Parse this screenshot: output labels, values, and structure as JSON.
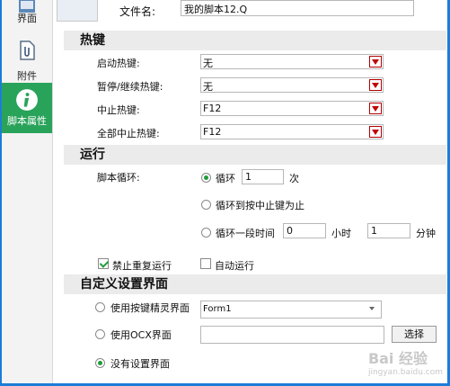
{
  "sidebar": {
    "items": [
      {
        "label": "界面",
        "icon": "interface-icon"
      },
      {
        "label": "附件",
        "icon": "attachment-icon"
      },
      {
        "label": "脚本属性",
        "icon": "info-icon"
      }
    ],
    "active_color": "#2aa35a"
  },
  "file": {
    "label": "文件名:",
    "value": "我的脚本12.Q"
  },
  "hotkeys": {
    "title": "热键",
    "start": {
      "label": "启动热键:",
      "value": "无"
    },
    "pause": {
      "label": "暂停/继续热键:",
      "value": "无"
    },
    "stop": {
      "label": "中止热键:",
      "value": "F12"
    },
    "stop_all": {
      "label": "全部中止热键:",
      "value": "F12"
    }
  },
  "run": {
    "title": "运行",
    "loop_label": "脚本循环:",
    "loop_option": "循环",
    "loop_count": "1",
    "loop_unit": "次",
    "until_stop": "循环到按中止键为止",
    "timed": "循环一段时间",
    "hours": "0",
    "hours_unit": "小时",
    "minutes": "1",
    "minutes_unit": "分钟",
    "no_rerun": "禁止重复运行",
    "autorun": "自动运行"
  },
  "custom": {
    "title": "自定义设置界面",
    "option_sprite": "使用按键精灵界面",
    "form_value": "Form1",
    "option_ocx": "使用OCX界面",
    "ocx_path": "",
    "select_button": "选择",
    "option_none": "没有设置界面"
  },
  "watermark": {
    "logo": "Bai 经验",
    "site": "jingyan.baidu.com"
  },
  "colors": {
    "frame": "#1b7dd8",
    "section_bg": "#ebebeb",
    "arrow": "#c00000"
  }
}
